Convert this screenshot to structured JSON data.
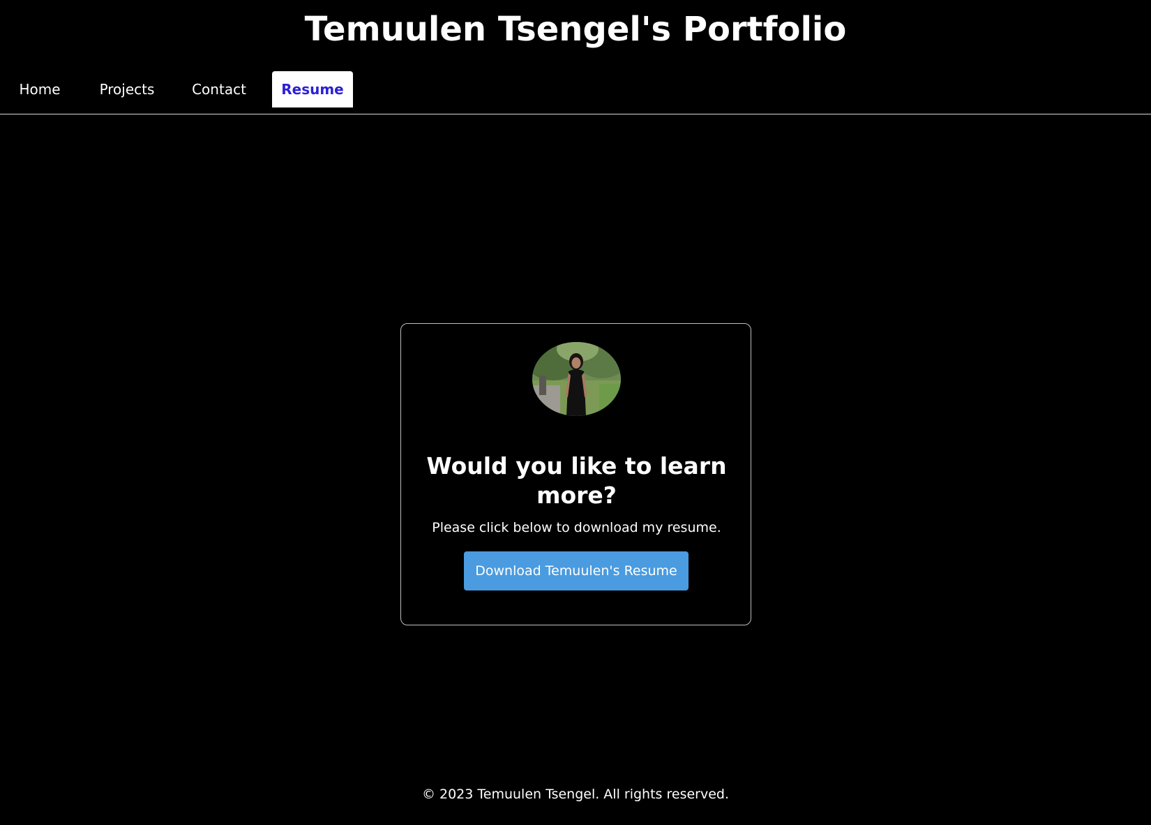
{
  "header": {
    "title": "Temuulen Tsengel's Portfolio"
  },
  "nav": {
    "tabs": [
      {
        "label": "Home",
        "active": false
      },
      {
        "label": "Projects",
        "active": false
      },
      {
        "label": "Contact",
        "active": false
      },
      {
        "label": "Resume",
        "active": true
      }
    ],
    "active_color": "#2a1fd6"
  },
  "resume_card": {
    "heading": "Would you like to learn more?",
    "text": "Please click below to download my resume.",
    "button_label": "Download Temuulen's Resume",
    "button_color": "#4a9be0",
    "avatar_alt": "profile-photo"
  },
  "footer": {
    "text": "© 2023 Temuulen Tsengel. All rights reserved."
  }
}
